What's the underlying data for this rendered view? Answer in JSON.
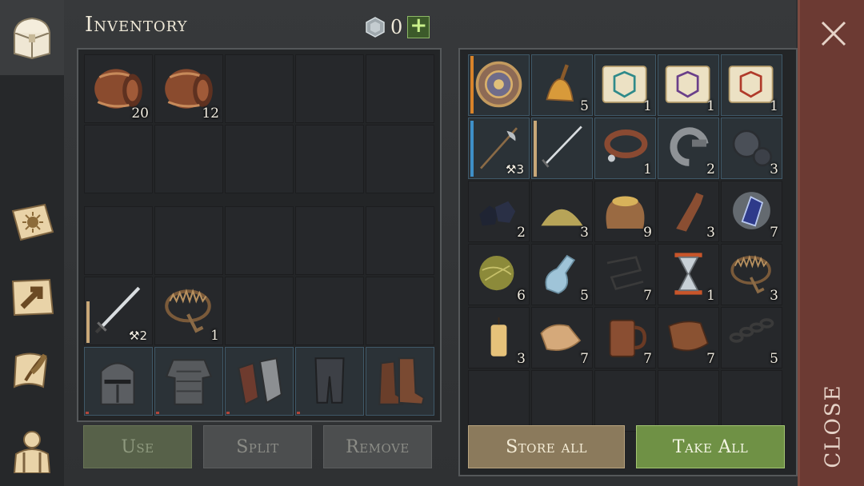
{
  "header": {
    "title": "Inventory",
    "currency": "0",
    "plus_label": "+"
  },
  "player": {
    "row1": [
      "20",
      "12",
      "",
      "",
      ""
    ],
    "sword_durability": "2"
  },
  "storage": {
    "counts": [
      "",
      "5",
      "1",
      "1",
      "1",
      "3",
      "",
      "1",
      "2",
      "3",
      "2",
      "3",
      "9",
      "3",
      "7",
      "6",
      "5",
      "7",
      "1",
      "3",
      "3",
      "7",
      "7",
      "7",
      "5"
    ]
  },
  "buttons": {
    "use": "Use",
    "split": "Split",
    "remove": "Remove",
    "store_all": "Store all",
    "take_all": "Take All"
  },
  "close": {
    "label": "CLOSE"
  },
  "colors": {
    "take_all": "#6f9145",
    "store_all": "#8b7a5c",
    "close_bg": "#6c3a33"
  }
}
